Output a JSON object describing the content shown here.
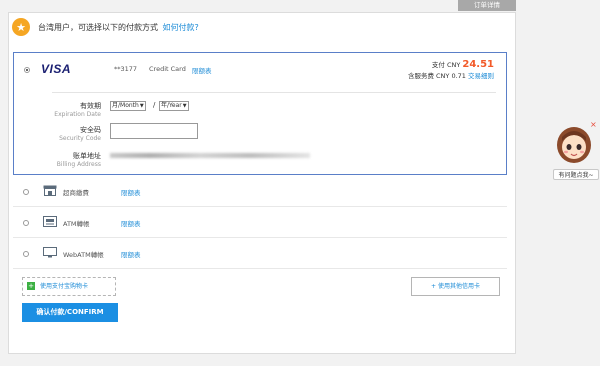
{
  "top_tab": {
    "label": "订单详情"
  },
  "header": {
    "icon": "yellow-coin-icon",
    "text": "台湾用户，可选择以下的付款方式",
    "link": "如何付款?"
  },
  "card": {
    "brand": "VISA",
    "masked_number": "**3177",
    "type_label": "Credit Card",
    "limit_link": "限额表",
    "pay_label": "支付 CNY",
    "pay_amount": "24.51",
    "fee_label": "含服务费 CNY 0.71",
    "fee_link": "交易细则",
    "expiry": {
      "label_cn": "有效期",
      "label_en": "Expiration Date",
      "month_value": "月/Month",
      "separator": "/",
      "year_value": "年/Year"
    },
    "security": {
      "label_cn": "安全码",
      "label_en": "Security Code",
      "value": ""
    },
    "billing": {
      "label_cn": "账单地址",
      "label_en": "Billing Address"
    }
  },
  "methods": [
    {
      "name": "超商繳費",
      "limit_link": "限额表",
      "icon": "store-icon"
    },
    {
      "name": "ATM轉帳",
      "limit_link": "限额表",
      "icon": "atm-icon"
    },
    {
      "name": "WebATM轉帳",
      "limit_link": "限额表",
      "icon": "monitor-icon"
    }
  ],
  "buttons": {
    "alipay_cart": "使用支付宝购物卡",
    "other_card": "使用其他信用卡",
    "confirm": "确认付款/CONFIRM"
  },
  "helper": {
    "label": "有问题点我~",
    "close": "×"
  },
  "colors": {
    "accent_blue": "#1b8fe3",
    "link_blue": "#1a8ad6",
    "amount_orange": "#f25a29",
    "card_border": "#5a7fc8"
  }
}
